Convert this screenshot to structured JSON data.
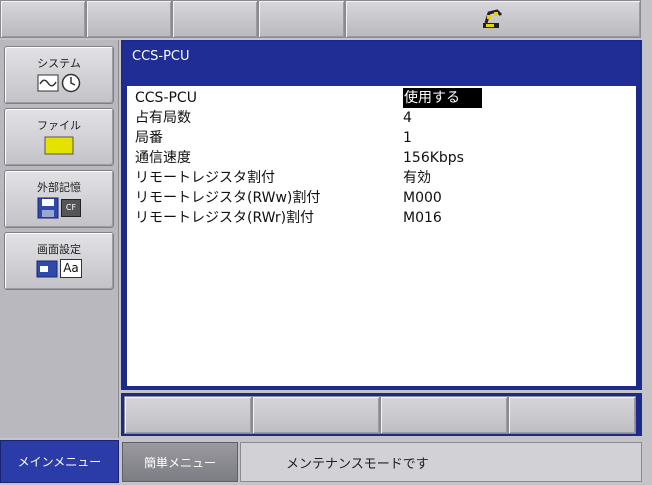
{
  "top_tabs": [
    "",
    "",
    "",
    "",
    ""
  ],
  "icons": {
    "top_right": "robot-arm-icon",
    "system": [
      "waveform-icon",
      "clock-icon"
    ],
    "file": [
      "folder-icon"
    ],
    "external_memory": [
      "floppy-disk-icon",
      "cf-card-icon"
    ],
    "display_settings": [
      "window-icon",
      "font-icon"
    ]
  },
  "colors": {
    "title_bar": "#1f2d94",
    "main_menu_active": "#2b3ba8",
    "selected_value_bg": "#000000"
  },
  "side_menu": {
    "items": [
      {
        "label": "システム"
      },
      {
        "label": "ファイル"
      },
      {
        "label": "外部記憶"
      },
      {
        "label": "画面設定"
      }
    ],
    "cf_text": "CF",
    "font_text": "Aa"
  },
  "window": {
    "title": "CCS-PCU",
    "rows": [
      {
        "key": "CCS-PCU",
        "value": "使用する"
      },
      {
        "key": "占有局数",
        "value": "4"
      },
      {
        "key": "局番",
        "value": "1"
      },
      {
        "key": "通信速度",
        "value": "156Kbps"
      },
      {
        "key": "リモートレジスタ割付",
        "value": "有効"
      },
      {
        "key": "リモートレジスタ(RWw)割付",
        "value": "M000"
      },
      {
        "key": "リモートレジスタ(RWr)割付",
        "value": "M016"
      }
    ]
  },
  "fkeys": [
    "",
    "",
    "",
    ""
  ],
  "bottom": {
    "main_menu": "メインメニュー",
    "simple_menu": "簡単メニュー",
    "status": "メンテナンスモードです"
  }
}
